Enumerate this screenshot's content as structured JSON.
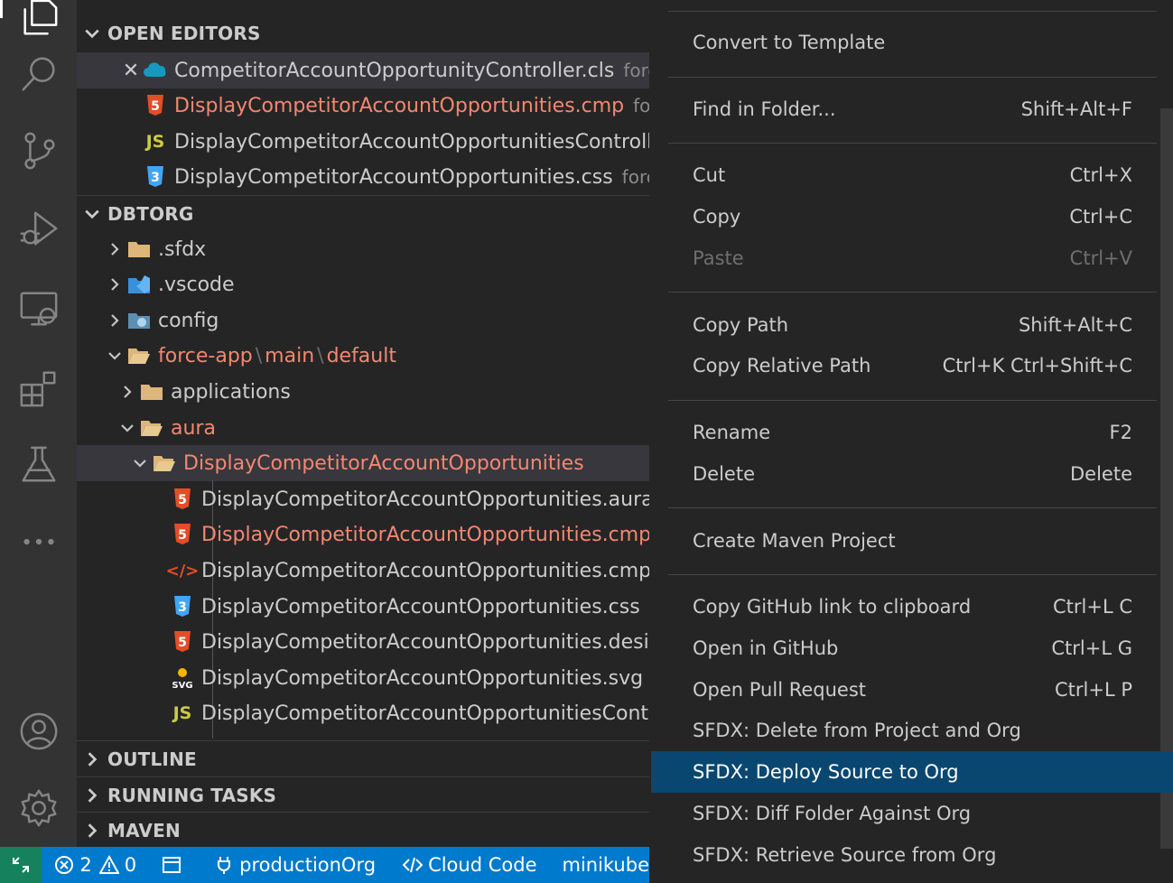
{
  "colors": {
    "activity_bg": "#333333",
    "sidebar_bg": "#252526",
    "status_bg": "#007acc",
    "remote_bg": "#16825d",
    "menu_highlight": "#094771",
    "error_text": "#f48771"
  },
  "activity_bar": {
    "items": [
      "explorer-icon",
      "search-icon",
      "source-control-icon",
      "run-debug-icon",
      "remote-explorer-icon",
      "extensions-icon",
      "testing-icon",
      "more-icon",
      "accounts-icon",
      "settings-gear-icon"
    ]
  },
  "sidebar": {
    "open_editors": {
      "title": "OPEN EDITORS",
      "items": [
        {
          "name": "CompetitorAccountOpportunityController.cls",
          "desc": "force",
          "icon": "salesforce-icon",
          "close": "✕"
        },
        {
          "name": "DisplayCompetitorAccountOpportunities.cmp",
          "desc": "forc",
          "icon": "html5-icon"
        },
        {
          "name": "DisplayCompetitorAccountOpportunitiesController",
          "desc": "",
          "icon": "js-icon"
        },
        {
          "name": "DisplayCompetitorAccountOpportunities.css",
          "desc": "force-",
          "icon": "css3-icon"
        }
      ]
    },
    "workspace": {
      "title": "DBTORG",
      "folders": [
        {
          "name": ".sfdx"
        },
        {
          "name": ".vscode"
        },
        {
          "name": "config"
        }
      ],
      "path_parts": [
        "force-app",
        "main",
        "default"
      ],
      "path_sep": "\\",
      "applications": "applications",
      "aura": "aura",
      "component_folder": "DisplayCompetitorAccountOpportunities",
      "files": [
        {
          "name": "DisplayCompetitorAccountOpportunities.auradc",
          "icon": "html5-icon",
          "error": false
        },
        {
          "name": "DisplayCompetitorAccountOpportunities.cmp",
          "icon": "html5-icon",
          "error": true
        },
        {
          "name": "DisplayCompetitorAccountOpportunities.cmp-n",
          "icon": "xml-icon",
          "error": false
        },
        {
          "name": "DisplayCompetitorAccountOpportunities.css",
          "icon": "css3-icon",
          "error": false
        },
        {
          "name": "DisplayCompetitorAccountOpportunities.design",
          "icon": "html5-icon",
          "error": false
        },
        {
          "name": "DisplayCompetitorAccountOpportunities.svg",
          "icon": "svg-icon",
          "error": false
        },
        {
          "name": "DisplayCompetitorAccountOpportunitiesContro",
          "icon": "js-icon",
          "error": false
        }
      ]
    },
    "outline": "OUTLINE",
    "running_tasks": "RUNNING TASKS",
    "maven": "MAVEN",
    "icon_text": {
      "js": "JS",
      "css": "3",
      "html": "5",
      "xml": "</>",
      "svg": "SVG"
    }
  },
  "status_bar": {
    "errors": "2",
    "warnings": "0",
    "org": "productionOrg",
    "cloud_code": "Cloud Code",
    "cluster": "minikube"
  },
  "context_menu": {
    "items": [
      {
        "label": "Convert to Template",
        "shortcut": ""
      },
      {
        "label": "Find in Folder...",
        "shortcut": "Shift+Alt+F"
      },
      {
        "label": "Cut",
        "shortcut": "Ctrl+X"
      },
      {
        "label": "Copy",
        "shortcut": "Ctrl+C"
      },
      {
        "label": "Paste",
        "shortcut": "Ctrl+V",
        "disabled": true
      },
      {
        "label": "Copy Path",
        "shortcut": "Shift+Alt+C"
      },
      {
        "label": "Copy Relative Path",
        "shortcut": "Ctrl+K Ctrl+Shift+C"
      },
      {
        "label": "Rename",
        "shortcut": "F2"
      },
      {
        "label": "Delete",
        "shortcut": "Delete"
      },
      {
        "label": "Create Maven Project",
        "shortcut": ""
      },
      {
        "label": "Copy GitHub link to clipboard",
        "shortcut": "Ctrl+L C"
      },
      {
        "label": "Open in GitHub",
        "shortcut": "Ctrl+L G"
      },
      {
        "label": "Open Pull Request",
        "shortcut": "Ctrl+L P"
      },
      {
        "label": "SFDX: Delete from Project and Org",
        "shortcut": ""
      },
      {
        "label": "SFDX: Deploy Source to Org",
        "shortcut": "",
        "highlighted": true
      },
      {
        "label": "SFDX: Diff Folder Against Org",
        "shortcut": ""
      },
      {
        "label": "SFDX: Retrieve Source from Org",
        "shortcut": ""
      }
    ]
  }
}
